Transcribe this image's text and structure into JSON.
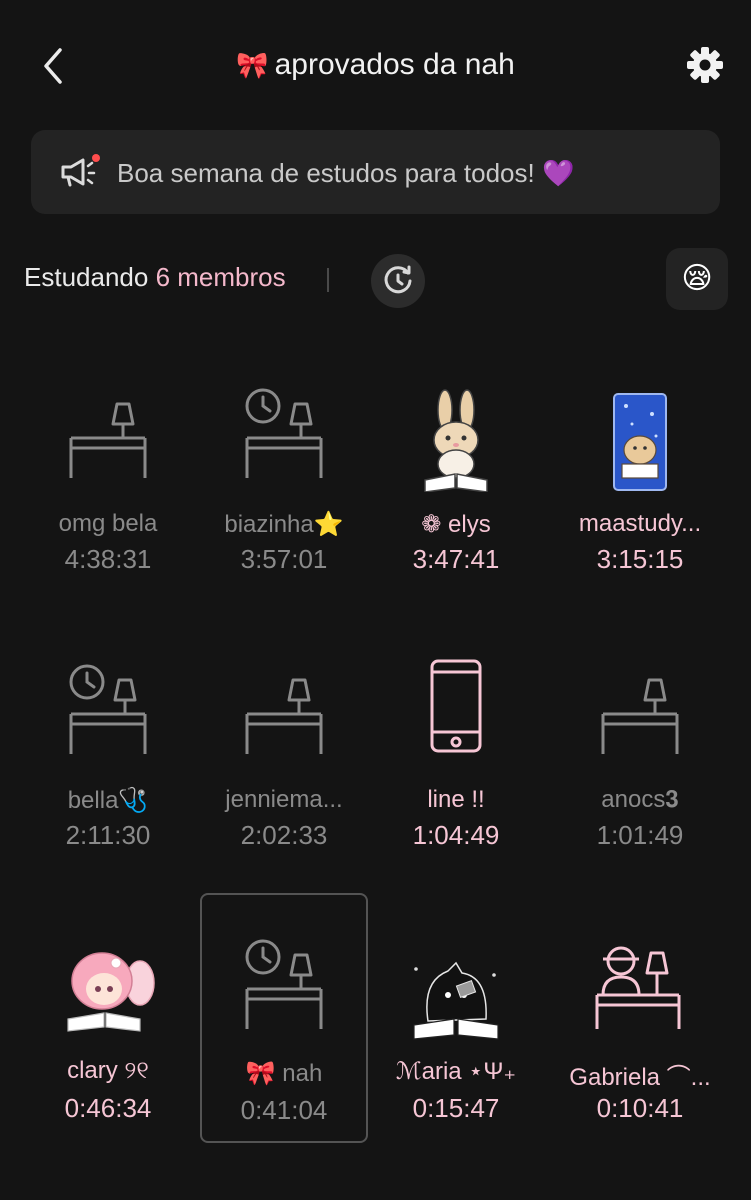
{
  "header": {
    "title": "aprovados da nah",
    "title_icon": "🎀",
    "back_icon": "chevron-left-icon",
    "settings_icon": "gear-icon"
  },
  "notice": {
    "text": "Boa semana de estudos para todos! 💜",
    "icon": "megaphone-icon"
  },
  "status": {
    "label": "Estudando",
    "count_text": "6 membros",
    "emoji": "😪"
  },
  "colors": {
    "background": "#141414",
    "card": "#232323",
    "pink": "#f6c6d5",
    "grey": "#8a8a8a"
  },
  "members": [
    {
      "name": "omg bela",
      "time": "4:38:31",
      "state": "idle",
      "avatar": "desk-icon"
    },
    {
      "name": "biazinha⭐",
      "time": "3:57:01",
      "state": "idle",
      "avatar": "desk-clock-icon"
    },
    {
      "name": "❁ elys",
      "time": "3:47:41",
      "state": "active",
      "avatar": "bunny-reading-sticker"
    },
    {
      "name": "maastudy...",
      "time": "3:15:15",
      "state": "active",
      "avatar": "puppy-studying-sticker"
    },
    {
      "name": "bella🩺",
      "time": "2:11:30",
      "state": "idle",
      "avatar": "desk-clock-icon"
    },
    {
      "name": "jenniema...",
      "time": "2:02:33",
      "state": "idle",
      "avatar": "desk-icon"
    },
    {
      "name": "line !!",
      "time": "1:04:49",
      "state": "active",
      "avatar": "phone-icon"
    },
    {
      "name": "anocs𝟑",
      "time": "1:01:49",
      "state": "idle",
      "avatar": "desk-icon"
    },
    {
      "name": "clary ୨୧",
      "time": "0:46:34",
      "state": "active",
      "avatar": "fairy-reading-sticker"
    },
    {
      "name": "🎀 nah",
      "time": "0:41:04",
      "state": "idle",
      "avatar": "desk-clock-icon",
      "selected": true
    },
    {
      "name": "ℳaria ⋆Ψ₊",
      "time": "0:15:47",
      "state": "active",
      "avatar": "cat-reading-sticker"
    },
    {
      "name": "Gabriela ⌒...",
      "time": "0:10:41",
      "state": "active",
      "avatar": "person-at-desk-icon"
    }
  ]
}
